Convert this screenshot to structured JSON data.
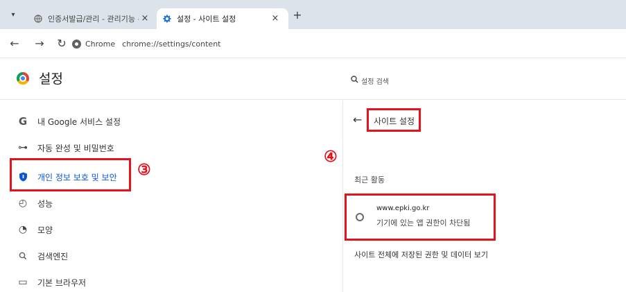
{
  "tabs": [
    {
      "title": "인증서발급/관리 - 관리기능 -",
      "active": false,
      "icon": "globe-icon"
    },
    {
      "title": "설정 - 사이트 설정",
      "active": true,
      "icon": "gear-icon"
    }
  ],
  "tab_close_glyph": "×",
  "new_tab_glyph": "+",
  "address_bar": {
    "chip_label": "Chrome",
    "url": "chrome://settings/content"
  },
  "settings": {
    "title": "설정",
    "search_placeholder": "설정 검색"
  },
  "sidebar": {
    "items": [
      {
        "label": "내 Google 서비스 설정",
        "icon": "google-g-icon",
        "glyph": "G"
      },
      {
        "label": "자동 완성 및 비밀번호",
        "icon": "key-icon",
        "glyph": "⊶"
      },
      {
        "label": "개인 정보 보호 및 보안",
        "icon": "shield-icon",
        "glyph": "⛉",
        "selected": true
      },
      {
        "label": "성능",
        "icon": "gauge-icon",
        "glyph": "◴"
      },
      {
        "label": "모양",
        "icon": "palette-icon",
        "glyph": "◔"
      },
      {
        "label": "검색엔진",
        "icon": "search-icon",
        "glyph": "⚲"
      },
      {
        "label": "기본 브라우저",
        "icon": "browser-window-icon",
        "glyph": "▭"
      }
    ]
  },
  "annotations": {
    "step3": "③",
    "step4": "④",
    "highlight_color": "#e3121b"
  },
  "panel": {
    "title": "사이트 설정",
    "recent_label": "최근 활동",
    "site": {
      "url": "www.epki.go.kr",
      "status": "기기에 있는 앱 권한이 차단됨"
    },
    "all_sites_link": "사이트 전체에 저장된 권한 및 데이터 보기"
  },
  "colors": {
    "tabstrip_bg": "#dde3ea",
    "selected_text": "#0b57d0"
  }
}
